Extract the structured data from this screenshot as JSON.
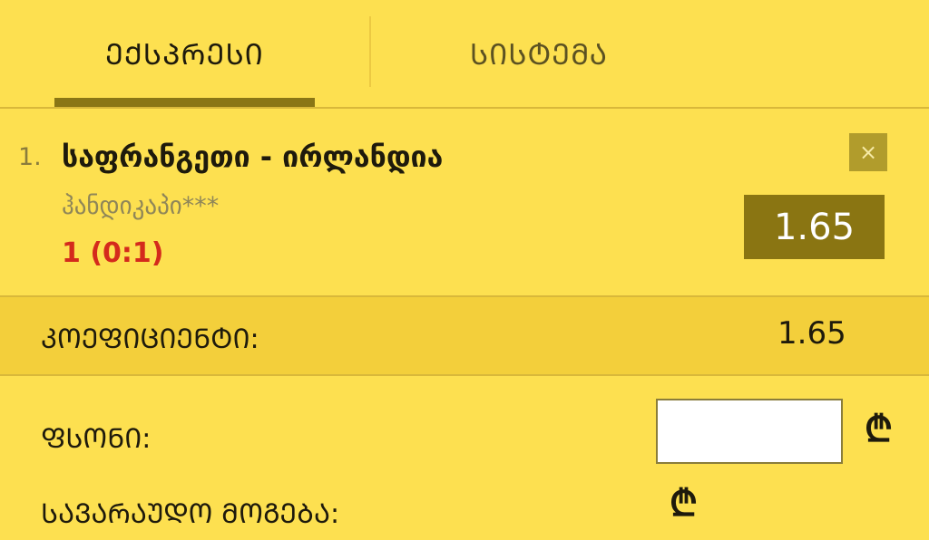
{
  "tabs": [
    {
      "label": "ᲔᲥᲡᲞᲠᲔᲡᲘ",
      "active": true
    },
    {
      "label": "ᲡᲘᲡᲢᲔᲛᲐ",
      "active": false
    }
  ],
  "bet": {
    "number": "1.",
    "title": "საფრანგეთი - ირლანდია",
    "market": "ჰანდიკაპი***",
    "pick": "1 (0:1)",
    "odds": "1.65",
    "close_label": "×"
  },
  "coefficient": {
    "label": "ᲙᲝᲔᲤᲘᲪᲘᲔᲜᲢᲘ:",
    "value": "1.65"
  },
  "stake": {
    "label": "ᲤᲡᲝᲜᲘ:",
    "value": "",
    "currency_icon": "₾"
  },
  "potential_win": {
    "label": "ᲡᲐᲕᲐᲠᲐᲣᲓᲝ ᲛᲝᲒᲔᲑᲐ:",
    "currency_icon": "₾"
  },
  "colors": {
    "background": "#fde050",
    "accent": "#8a7512",
    "pick": "#d42a1c"
  }
}
